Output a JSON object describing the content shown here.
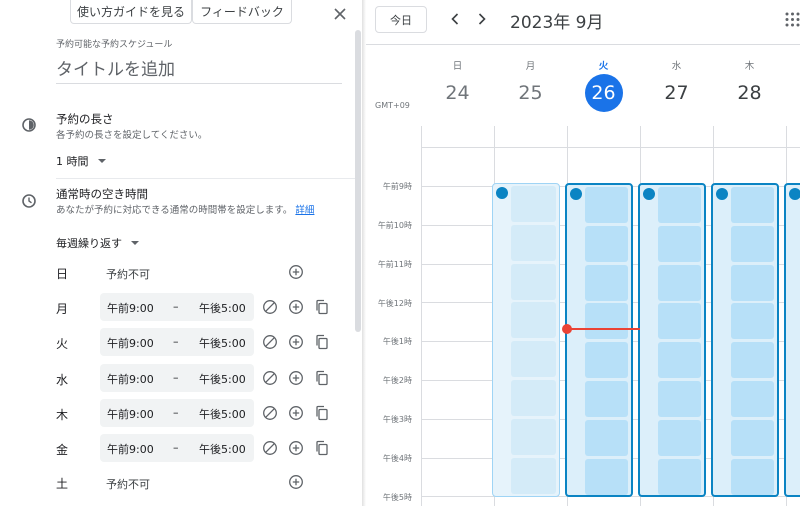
{
  "panel": {
    "help_button": "使い方ガイドを見る",
    "feedback_button": "フィードバック",
    "schedule_caption": "予約可能な予約スケジュール",
    "title_placeholder": "タイトルを追加",
    "duration": {
      "title": "予約の長さ",
      "subtitle": "各予約の長さを設定してください。",
      "value": "1 時間"
    },
    "availability": {
      "title": "通常時の空き時間",
      "subtitle": "あなたが予約に対応できる通常の時間帯を設定します。",
      "link": "詳細"
    },
    "repeat": "毎週繰り返す",
    "days": [
      {
        "label": "日",
        "start": "",
        "dash": "",
        "end": "",
        "unavailable": "予約不可"
      },
      {
        "label": "月",
        "start": "午前9:00",
        "dash": "–",
        "end": "午後5:00",
        "unavailable": ""
      },
      {
        "label": "火",
        "start": "午前9:00",
        "dash": "–",
        "end": "午後5:00",
        "unavailable": ""
      },
      {
        "label": "水",
        "start": "午前9:00",
        "dash": "–",
        "end": "午後5:00",
        "unavailable": ""
      },
      {
        "label": "木",
        "start": "午前9:00",
        "dash": "–",
        "end": "午後5:00",
        "unavailable": ""
      },
      {
        "label": "金",
        "start": "午前9:00",
        "dash": "–",
        "end": "午後5:00",
        "unavailable": ""
      },
      {
        "label": "土",
        "start": "",
        "dash": "",
        "end": "",
        "unavailable": "予約不可"
      }
    ]
  },
  "calendar": {
    "today_button": "今日",
    "month_title": "2023年 9月",
    "timezone": "GMT+09",
    "days": [
      {
        "dow": "日",
        "num": "24"
      },
      {
        "dow": "月",
        "num": "25"
      },
      {
        "dow": "火",
        "num": "26"
      },
      {
        "dow": "水",
        "num": "27"
      },
      {
        "dow": "木",
        "num": "28"
      }
    ],
    "hours": [
      "午前9時",
      "午前10時",
      "午前11時",
      "午後12時",
      "午後1時",
      "午後2時",
      "午後3時",
      "午後4時",
      "午後5時"
    ]
  },
  "colors": {
    "accent": "#1a73e8",
    "now_line": "#ea4335",
    "slot_fill": "#b7e0f8",
    "slot_border": "#0b84c3"
  }
}
